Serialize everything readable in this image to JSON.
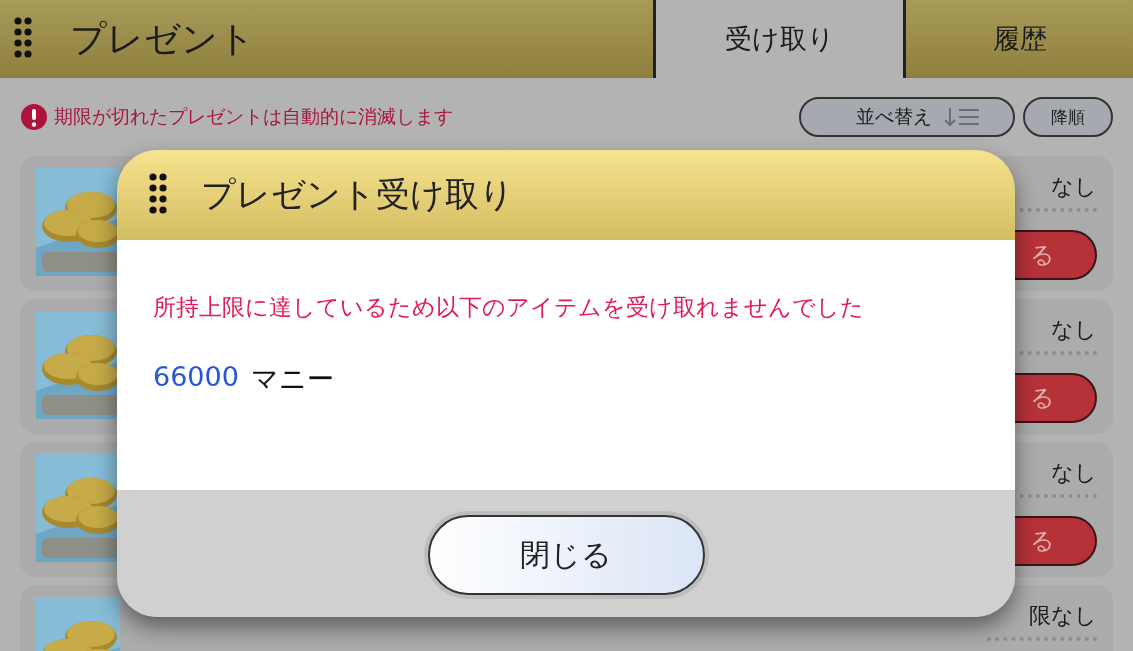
{
  "header": {
    "title": "プレゼント",
    "tabs": [
      {
        "label": "受け取り",
        "selected": true
      },
      {
        "label": "履歴",
        "selected": false
      }
    ]
  },
  "notice": "期限が切れたプレゼントは自動的に消滅します",
  "sort": {
    "label": "並べ替え",
    "order": "降順"
  },
  "items": [
    {
      "status": "なし",
      "action": "る"
    },
    {
      "status": "なし",
      "action": "る"
    },
    {
      "status": "なし",
      "action": "る"
    },
    {
      "status": "限なし"
    }
  ],
  "dialog": {
    "title": "プレゼント受け取り",
    "message": "所持上限に達しているため以下のアイテムを受け取れませんでした",
    "amount": "66000",
    "unit": "マニー",
    "button": "閉じる"
  }
}
